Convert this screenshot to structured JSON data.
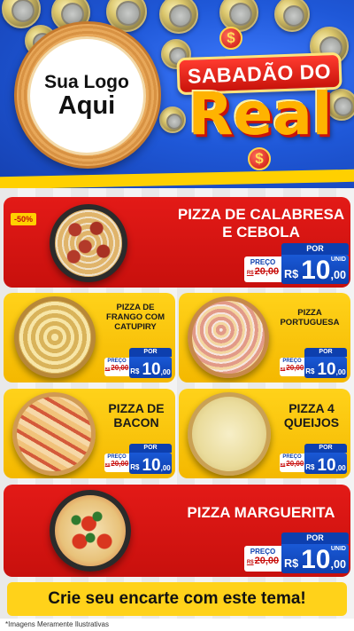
{
  "header": {
    "logo_line1": "Sua Logo",
    "logo_line2": "Aqui",
    "title_top": "SABADÃO DO",
    "title_main": "Real",
    "coin_symbol": "$"
  },
  "price_tag": {
    "por_label": "POR",
    "preco_label": "PREÇO",
    "old_prefix": "R$",
    "old_price": "20,00",
    "currency": "R$",
    "price_int": "10",
    "price_cents": ",00",
    "unit_label": "UNID"
  },
  "products": [
    {
      "name_line1": "PIZZA DE CALABRESA",
      "name_line2": "E CEBOLA",
      "badge": "-50%"
    },
    {
      "name_line1": "PIZZA DE",
      "name_line2": "FRANGO COM",
      "name_line3": "CATUPIRY"
    },
    {
      "name_line1": "PIZZA",
      "name_line2": "PORTUGUESA"
    },
    {
      "name_line1": "PIZZA DE",
      "name_line2": "BACON"
    },
    {
      "name_line1": "PIZZA 4",
      "name_line2": "QUEIJOS"
    },
    {
      "name_line1": "PIZZA MARGUERITA"
    }
  ],
  "cta": "Crie seu encarte com este tema!",
  "footnote": "*Imagens Meramente Ilustrativas",
  "colors": {
    "brand_blue": "#1f58d8",
    "card_red": "#e31a17",
    "card_yellow": "#ffd21a",
    "tag_blue": "#0d3fae"
  }
}
